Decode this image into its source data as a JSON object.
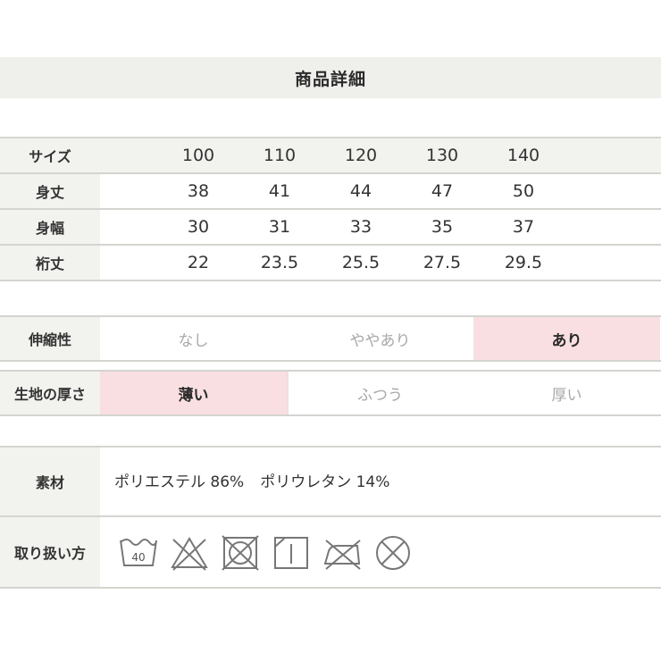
{
  "header": {
    "title": "商品詳細"
  },
  "size_table": {
    "header": {
      "label": "サイズ",
      "sizes": [
        "100",
        "110",
        "120",
        "130",
        "140"
      ]
    },
    "rows": [
      {
        "label": "身丈",
        "values": [
          "38",
          "41",
          "44",
          "47",
          "50"
        ]
      },
      {
        "label": "身幅",
        "values": [
          "30",
          "31",
          "33",
          "35",
          "37"
        ]
      },
      {
        "label": "裄丈",
        "values": [
          "22",
          "23.5",
          "25.5",
          "27.5",
          "29.5"
        ]
      }
    ]
  },
  "stretch": {
    "label": "伸縮性",
    "options": [
      "なし",
      "ややあり",
      "あり"
    ],
    "selected": "あり"
  },
  "thickness": {
    "label": "生地の厚さ",
    "options": [
      "薄い",
      "ふつう",
      "厚い"
    ],
    "selected": "薄い"
  },
  "material": {
    "label": "素材",
    "parts": [
      "ポリエステル 86%",
      "ポリウレタン 14%"
    ]
  },
  "care": {
    "label": "取り扱い方",
    "wash_temp": "40",
    "icons": [
      "wash-40-icon",
      "no-bleach-icon",
      "no-tumble-dry-icon",
      "line-dry-icon",
      "iron-prohibited-icon",
      "no-dry-clean-icon"
    ]
  },
  "colors": {
    "label_bg": "#f2f2ef",
    "header_bg": "#efefeb",
    "highlight_bg": "#f9dfe1",
    "border": "#d4d4d0",
    "muted_text": "#a8a8a8"
  }
}
